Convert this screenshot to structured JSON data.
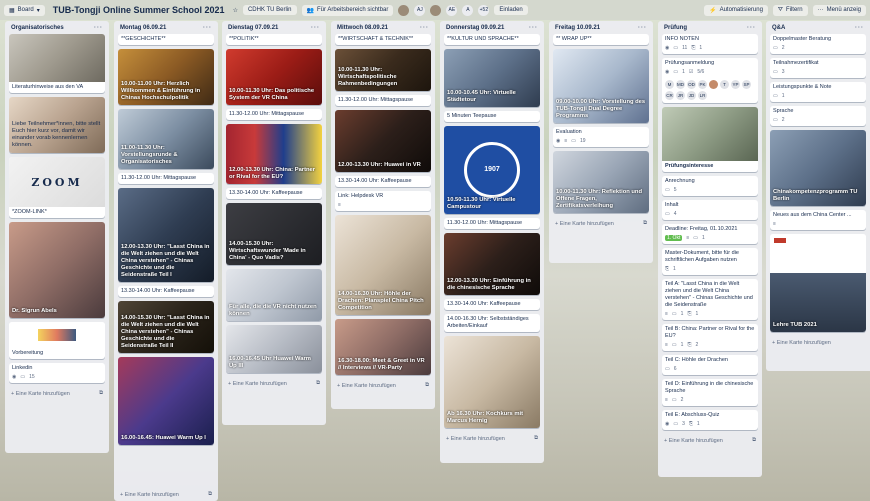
{
  "topbar": {
    "board_label": "Board",
    "title": "TUB-Tongji Online Summer School 2021",
    "workspace": "CDHK TU Berlin",
    "visibility": "Für Arbeitsbereich sichtbar",
    "members": [
      "AJ",
      "AE",
      "A"
    ],
    "extra_count": "+52",
    "invite": "Einladen",
    "automation": "Automatisierung",
    "filter": "Filtern",
    "menu": "Menü anzeig"
  },
  "lists": {
    "orga": {
      "title": "Organisatorisches",
      "c1": "Literaturhinweise aus den VA",
      "c2": "Liebe Teilnehmer*innen, bitte stellt Euch hier kurz vor, damit wir einander vorab kennenlernen können.",
      "c3_zoom": "ZOOM",
      "c3": "*ZOOM-LINK*",
      "c4": "Dr. Sigrun Abels",
      "c5": "Vorbereitung",
      "c6": "Linkedin",
      "c6_count": "15",
      "add": "+ Eine Karte hinzufügen"
    },
    "mo": {
      "title": "Montag 06.09.21",
      "c1": "**GESCHICHTE**",
      "c2": "10.00-11.00 Uhr: Herzlich Willkommen & Einführung in Chinas Hochschulpolitik",
      "c3": "11.00-11.30 Uhr: Vorstellungsrunde & Organisatorisches",
      "c4": "11.30-12.00 Uhr: Mittagspause",
      "c5": "12.00-13.30 Uhr: \"Lasst China in die Welt ziehen und die Welt China verstehen\" - Chinas Geschichte und die Seidenstraße Teil I",
      "c6": "13.30-14.00 Uhr: Kaffeepause",
      "c7": "14.00-15.30 Uhr: \"Lasst China in die Welt ziehen und die Welt China verstehen\" - Chinas Geschichte und die Seidenstraße Teil II",
      "c8": "16.00-16.45: Huawei Warm Up I",
      "add": "+ Eine Karte hinzufügen"
    },
    "di": {
      "title": "Dienstag 07.09.21",
      "c1": "**POLITIK**",
      "c2": "10.00-11.30 Uhr: Das politische System der VR China",
      "c3": "11.30-12.00 Uhr: Mittagspause",
      "c4": "12.00-13.30 Uhr: China: Partner or Rival for the EU?",
      "c5": "13.30-14.00 Uhr: Kaffeepause",
      "c6": "14.00-15.30 Uhr: Wirtschaftswunder 'Made in China' - Quo Vadis?",
      "c7": "Für alle, die die VR nicht nutzen können",
      "c8": "16.00-16.45 Uhr Huawei Warm Up III",
      "add": "+ Eine Karte hinzufügen"
    },
    "mi": {
      "title": "Mittwoch 08.09.21",
      "c1": "**WIRTSCHAFT & TECHNIK**",
      "c2": "10.00-11.30 Uhr: Wirtschaftspolitische Rahmenbedingungen",
      "c3": "11.30-12.00 Uhr: Mittagspause",
      "c4": "12.00-13.30 Uhr: Huawei in VR",
      "c5": "13.30-14.00 Uhr: Kaffeepause",
      "c6": "Link: Helpdesk VR",
      "c7": "14.00-16.30 Uhr: Höhle der Drachen: Planspiel China Pitch Competition",
      "c8": "16.30-18.00: Meet & Greet in VR // Interviews // VR-Party",
      "add": "+ Eine Karte hinzufügen"
    },
    "do": {
      "title": "Donnerstag 09.09.21",
      "c1": "**KULTUR UND SPRACHE**",
      "c2": "10.00-10.45 Uhr: Virtuelle Städtetour",
      "c3": "5 Minuten Teepause",
      "c4": "10.50-11.30 Uhr: Virtuelle Campustour",
      "c4_seal": "1907",
      "c5": "11.30-12.00 Uhr: Mittagspause",
      "c6": "12.00-13.30 Uhr: Einführung in die chinesische Sprache",
      "c7": "13.30-14.00 Uhr: Kaffeepause",
      "c8": "14.00-16.30 Uhr: Selbstständiges Arbeiten/Einkauf",
      "c9": "Ab 16.30 Uhr: Kochkurs mit Marcus Hernig",
      "add": "+ Eine Karte hinzufügen"
    },
    "fr": {
      "title": "Freitag 10.09.21",
      "c1": "** WRAP UP**",
      "c2": "09.00-10.00 Uhr: Vorstellung des TUB-Tongji Dual Degree Programms",
      "c3": "Evaluation",
      "c3_count": "19",
      "c4": "10.00-11.30 Uhr: Reflektion und Offene Fragen, Zertifikatsverleihung",
      "add": "+ Eine Karte hinzufügen"
    },
    "pr": {
      "title": "Prüfung",
      "c1": "INFO NOTEN",
      "c1_b": [
        "11",
        "1"
      ],
      "c2": "Prüfungsanmeldung",
      "c2_b": [
        "1",
        "5/6"
      ],
      "c2_tags": [
        "M",
        "MD",
        "OD",
        "PK",
        "",
        "T",
        "YP",
        "SP",
        "CR",
        "JR",
        "JD",
        "LR"
      ],
      "c3": "Prüfungsinteresse",
      "c4": "Anrechnung",
      "c4_b": "5",
      "c5": "Inhalt",
      "c5_b": "4",
      "c6": "Deadline: Freitag, 01.10.2021",
      "c6_due": "1. Okt",
      "c6_b": "1",
      "c7": "Master-Dokument, bitte für die schriftlichen Aufgaben nutzen",
      "c7_b": "1",
      "c8": "Teil A: \"Lasst China in die Welt ziehen und die Welt China verstehen\" - Chinas Geschichte und die Seidenstraße",
      "c8_b": [
        "1",
        "1"
      ],
      "c9": "Teil B: China: Partner or Rival for the EU?",
      "c9_b": [
        "1",
        "2"
      ],
      "c10": "Teil C: Höhle der Drachen",
      "c10_b": "6",
      "c11": "Teil D: Einführung in die chinesische Sprache",
      "c11_b": "2",
      "c12": "Teil E: Abschluss-Quiz",
      "c12_b": [
        "3",
        "1"
      ],
      "add": "+ Eine Karte hinzufügen"
    },
    "qa": {
      "title": "Q&A",
      "c1": "Doppelmaster Beratung",
      "c1_b": "2",
      "c2": "Teilnahmezertifikat",
      "c2_b": "3",
      "c3": "Leistungspunkte & Note",
      "c3_b": "1",
      "c4": "Sprache",
      "c4_b": "2",
      "c5": "Chinakompetenzprogramm TU Berlin",
      "c6": "Neues aus dem China Center ...",
      "c7": "Lehre TUB 2021",
      "add": "+ Eine Karte hinzufügen"
    }
  }
}
